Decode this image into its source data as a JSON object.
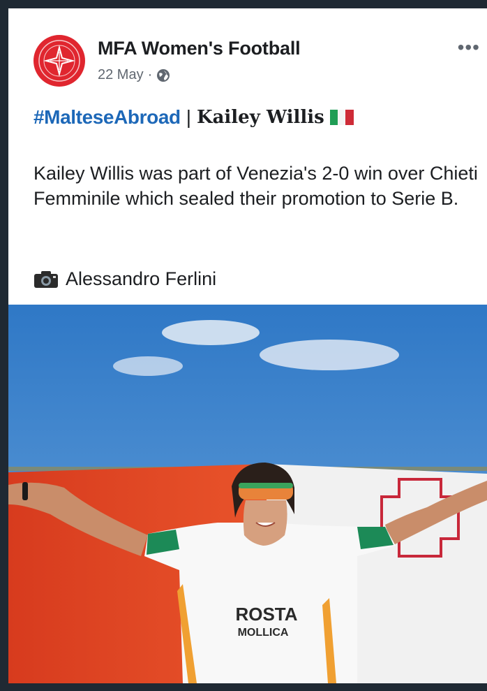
{
  "post": {
    "page_name": "MFA Women's Football",
    "date": "22 May",
    "date_sep": "·",
    "privacy_icon": "globe-icon",
    "more_icon": "more-options-icon",
    "more_label": "•••",
    "hashtag": "#MalteseAbroad",
    "separator": "|",
    "player_name": "Kailey Willis",
    "flag_icon": "italy-flag-icon",
    "body": "Kailey Willis was part of Venezia's 2-0 win over Chieti Femminile which sealed their promotion to Serie B.",
    "credit_icon": "camera-icon",
    "credit": "Alessandro Ferlini"
  },
  "photo": {
    "jersey_text_1": "ROSTA",
    "jersey_text_2": "MOLLICA"
  },
  "colors": {
    "brand_red": "#e0262f",
    "hashtag_blue": "#1d68b8",
    "italy_green": "#1f9d55",
    "italy_red": "#ce2b37"
  }
}
